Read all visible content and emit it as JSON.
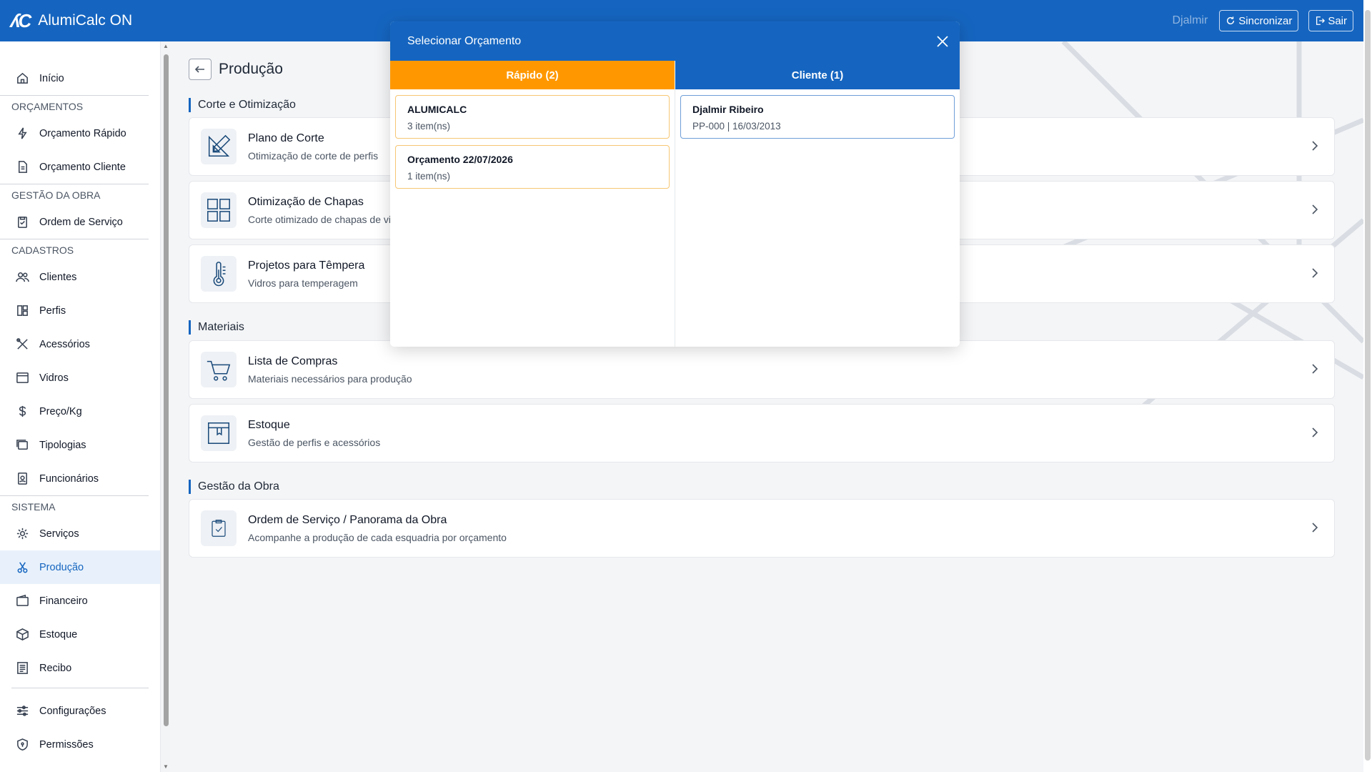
{
  "header": {
    "app_title": "AlumiCalc ON",
    "logo_text": "ʎC",
    "user_name": "Djalmir",
    "sync_label": "Sincronizar",
    "logout_label": "Sair"
  },
  "sidebar": {
    "home": "Início",
    "sections": {
      "orcamentos": "ORÇAMENTOS",
      "gestao": "GESTÃO DA OBRA",
      "cadastros": "CADASTROS",
      "sistema": "SISTEMA"
    },
    "items": {
      "orcamento_rapido": "Orçamento Rápido",
      "orcamento_cliente": "Orçamento Cliente",
      "ordem_servico": "Ordem de Serviço",
      "clientes": "Clientes",
      "perfis": "Perfis",
      "acessorios": "Acessórios",
      "vidros": "Vidros",
      "preco_kg": "Preço/Kg",
      "tipologias": "Tipologias",
      "funcionarios": "Funcionários",
      "servicos": "Serviços",
      "producao": "Produção",
      "financeiro": "Financeiro",
      "estoque": "Estoque",
      "recibo": "Recibo",
      "configuracoes": "Configurações",
      "permissoes": "Permissões"
    }
  },
  "page": {
    "title": "Produção",
    "sections": {
      "corte": "Corte e Otimização",
      "materiais": "Materiais",
      "gestao": "Gestão da Obra"
    },
    "cards": {
      "plano_corte": {
        "title": "Plano de Corte",
        "sub": "Otimização de corte de perfis"
      },
      "otimizacao_chapas": {
        "title": "Otimização de Chapas",
        "sub": "Corte otimizado de chapas de vidro"
      },
      "tempera": {
        "title": "Projetos para Têmpera",
        "sub": "Vidros para temperagem"
      },
      "compras": {
        "title": "Lista de Compras",
        "sub": "Materiais necessários para produção"
      },
      "estoque": {
        "title": "Estoque",
        "sub": "Gestão de perfis e acessórios"
      },
      "ordem": {
        "title": "Ordem de Serviço / Panorama da Obra",
        "sub": "Acompanhe a produção de cada esquadria por orçamento"
      }
    }
  },
  "modal": {
    "title": "Selecionar Orçamento",
    "tab_rapido": "Rápido (2)",
    "tab_cliente": "Cliente (1)",
    "rapido_items": [
      {
        "title": "ALUMICALC",
        "sub": "3 item(ns)"
      },
      {
        "title": "Orçamento 22/07/2026",
        "sub": "1 item(ns)"
      }
    ],
    "cliente_items": [
      {
        "title": "Djalmir Ribeiro",
        "sub": "PP-000 | 16/03/2013"
      }
    ]
  },
  "colors": {
    "primary": "#1565c0",
    "accent_orange": "#ff9800",
    "active_bg": "#e8f1fb"
  }
}
